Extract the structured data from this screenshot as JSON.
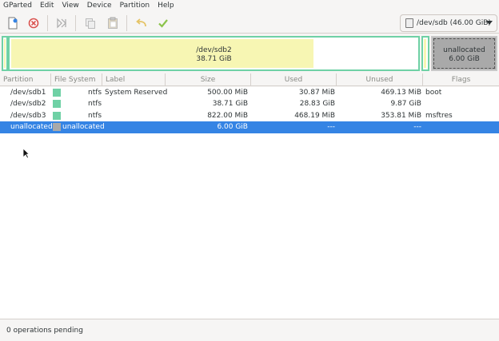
{
  "menubar": {
    "items": [
      "GParted",
      "Edit",
      "View",
      "Device",
      "Partition",
      "Help"
    ]
  },
  "toolbar": {
    "icons": [
      "new-icon",
      "delete-icon",
      "resize-move-icon",
      "copy-icon",
      "paste-icon",
      "undo-icon",
      "apply-icon"
    ],
    "device": "/dev/sdb (46.00 GiB)"
  },
  "diskmap": {
    "sdb2_name": "/dev/sdb2",
    "sdb2_size": "38.71 GiB",
    "unalloc_name": "unallocated",
    "unalloc_size": "6.00 GiB"
  },
  "table": {
    "headers": [
      "Partition",
      "File System",
      "Label",
      "Size",
      "Used",
      "Unused",
      "Flags"
    ],
    "rows": [
      {
        "partition": "/dev/sdb1",
        "fs": "ntfs",
        "label": "System Reserved",
        "size": "500.00 MiB",
        "used": "30.87 MiB",
        "unused": "469.13 MiB",
        "flags": "boot"
      },
      {
        "partition": "/dev/sdb2",
        "fs": "ntfs",
        "label": "",
        "size": "38.71 GiB",
        "used": "28.83 GiB",
        "unused": "9.87 GiB",
        "flags": ""
      },
      {
        "partition": "/dev/sdb3",
        "fs": "ntfs",
        "label": "",
        "size": "822.00 MiB",
        "used": "468.19 MiB",
        "unused": "353.81 MiB",
        "flags": "msftres"
      },
      {
        "partition": "unallocated",
        "fs": "unallocated",
        "label": "",
        "size": "6.00 GiB",
        "used": "---",
        "unused": "---",
        "flags": ""
      }
    ]
  },
  "colors": {
    "ntfs": "#6fd1a5",
    "unallocated": "#a9a9a9",
    "selection": "#3584e4"
  },
  "status": {
    "text": "0 operations pending"
  }
}
